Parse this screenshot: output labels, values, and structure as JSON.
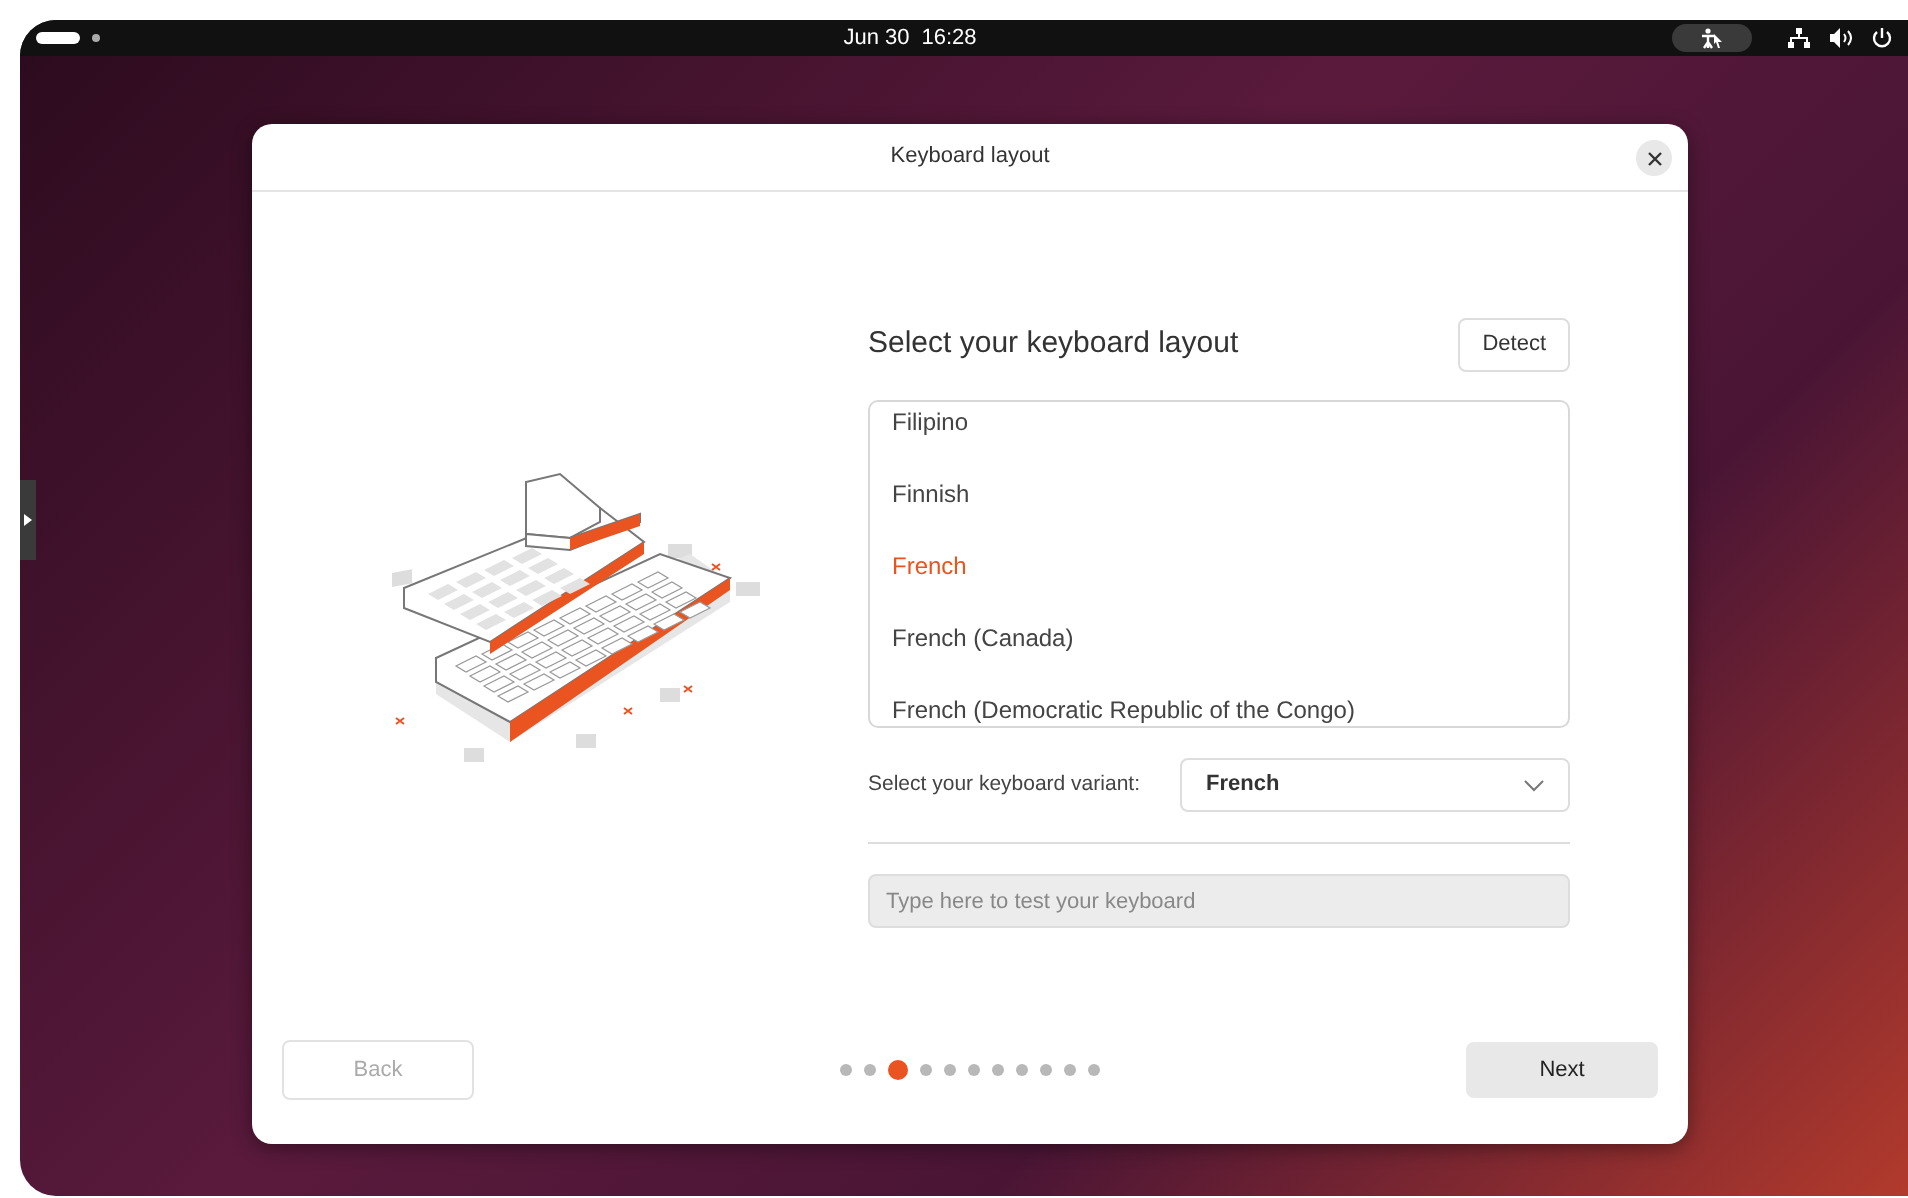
{
  "top_bar": {
    "date": "Jun 30",
    "time": "16:28"
  },
  "dialog": {
    "title": "Keyboard layout"
  },
  "layout": {
    "heading": "Select your keyboard layout",
    "detect_button": "Detect",
    "items": [
      {
        "label": "Filipino",
        "selected": false
      },
      {
        "label": "Finnish",
        "selected": false
      },
      {
        "label": "French",
        "selected": true
      },
      {
        "label": "French (Canada)",
        "selected": false
      },
      {
        "label": "French (Democratic Republic of the Congo)",
        "selected": false
      }
    ]
  },
  "variant": {
    "label": "Select your keyboard variant:",
    "value": "French"
  },
  "test_field": {
    "placeholder": "Type here to test your keyboard"
  },
  "footer": {
    "back": {
      "label": "Back",
      "disabled": true
    },
    "next": {
      "label": "Next",
      "disabled": false
    },
    "steps": [
      {
        "selected": false
      },
      {
        "selected": false
      },
      {
        "selected": true
      },
      {
        "selected": false
      },
      {
        "selected": false
      },
      {
        "selected": false
      },
      {
        "selected": false
      },
      {
        "selected": false
      },
      {
        "selected": false
      },
      {
        "selected": false
      },
      {
        "selected": false
      }
    ]
  }
}
